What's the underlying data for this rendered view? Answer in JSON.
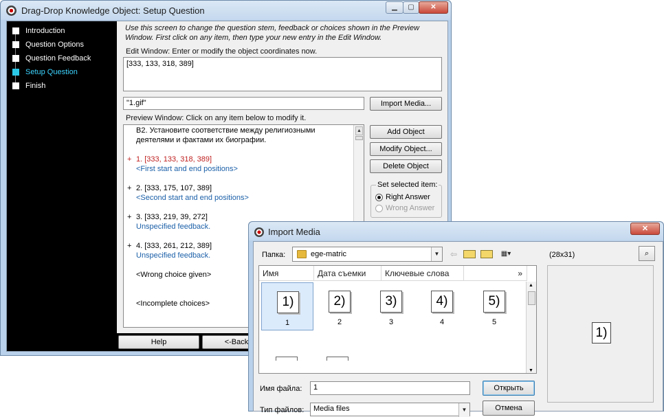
{
  "main_window": {
    "title": "Drag-Drop Knowledge Object: Setup Question",
    "minimize": "▁",
    "maximize": "▢",
    "close": "✕"
  },
  "sidebar": {
    "steps": [
      {
        "label": "Introduction",
        "active": false
      },
      {
        "label": "Question Options",
        "active": false
      },
      {
        "label": "Question Feedback",
        "active": false
      },
      {
        "label": "Setup Question",
        "active": true
      },
      {
        "label": "Finish",
        "active": false
      }
    ]
  },
  "setup": {
    "instructions": "Use this screen to change the question stem, feedback or choices shown in the Preview Window. First click on any item, then type your new entry in the Edit Window.",
    "edit_label": "Edit Window: Enter or modify the object coordinates now.",
    "edit_value": "[333, 133, 318, 389]",
    "file_value": "\"1.gif\"",
    "import_button": "Import Media...",
    "preview_label": "Preview Window: Click on any item below to modify it.",
    "preview_lines": [
      {
        "plus": "",
        "text": "В2. Установите соответствие между религиозными",
        "color": "black"
      },
      {
        "plus": "",
        "text": "деятелями и фактами их биографии.",
        "color": "black"
      },
      {
        "plus": "+",
        "text": "1. [333, 133, 318, 389]",
        "color": "red"
      },
      {
        "plus": "",
        "text": "<First start and end positions>",
        "color": "blue"
      },
      {
        "plus": "+",
        "text": "2. [333, 175, 107, 389]",
        "color": "black"
      },
      {
        "plus": "",
        "text": "<Second start and end positions>",
        "color": "blue"
      },
      {
        "plus": "+",
        "text": "3. [333, 219, 39, 272]",
        "color": "black"
      },
      {
        "plus": "",
        "text": "Unspecified feedback.",
        "color": "blue"
      },
      {
        "plus": "+",
        "text": "4. [333, 261, 212, 389]",
        "color": "black"
      },
      {
        "plus": "",
        "text": "Unspecified feedback.",
        "color": "blue"
      },
      {
        "plus": "",
        "text": "<Wrong choice given>",
        "color": "black"
      },
      {
        "plus": "",
        "text": "<Incomplete choices>",
        "color": "black"
      }
    ],
    "add_button": "Add Object",
    "modify_button": "Modify Object...",
    "delete_button": "Delete Object",
    "set_group_label": "Set selected item:",
    "right_answer": "Right Answer",
    "wrong_answer": "Wrong Answer",
    "help_button": "Help",
    "back_button": "<-Back"
  },
  "import_dialog": {
    "title": "Import Media",
    "close": "✕",
    "folder_label": "Папка:",
    "folder_value": "ege-matric",
    "size_label": "(28x31)",
    "columns": [
      "Имя",
      "Дата съемки",
      "Ключевые слова"
    ],
    "more_columns": "»",
    "files": [
      {
        "glyph": "1)",
        "caption": "1",
        "selected": true
      },
      {
        "glyph": "2)",
        "caption": "2",
        "selected": false
      },
      {
        "glyph": "3)",
        "caption": "3",
        "selected": false
      },
      {
        "glyph": "4)",
        "caption": "4",
        "selected": false
      },
      {
        "glyph": "5)",
        "caption": "5",
        "selected": false
      }
    ],
    "preview_glyph": "1)",
    "filename_label": "Имя файла:",
    "filename_value": "1",
    "filetype_label": "Тип файлов:",
    "filetype_value": "Media files",
    "open_button": "Открыть",
    "cancel_button": "Отмена"
  },
  "icons": {
    "back": "back-arrow-icon",
    "up": "up-folder-icon",
    "new_folder": "new-folder-icon",
    "views": "view-menu-icon",
    "preview": "preview-magnifier-icon"
  }
}
